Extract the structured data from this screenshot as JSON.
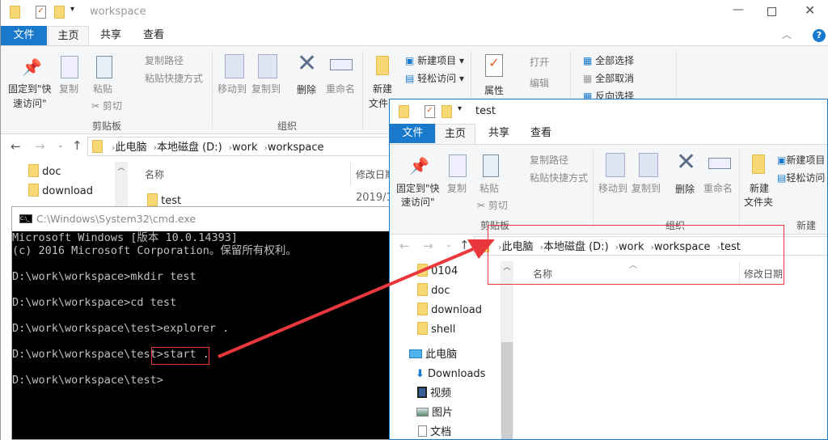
{
  "back_window": {
    "title": "workspace",
    "tabs": {
      "file": "文件",
      "home": "主页",
      "share": "共享",
      "view": "查看"
    },
    "ribbon": {
      "pin": "固定到\"快",
      "pin2": "速访问\"",
      "copy": "复制",
      "paste": "粘贴",
      "copy_path": "复制路径",
      "paste_shortcut": "粘贴快捷方式",
      "cut": "剪切",
      "clipboard": "剪贴板",
      "move_to": "移动到",
      "copy_to": "复制到",
      "delete": "删除",
      "rename": "重命名",
      "organize": "组织",
      "new_folder": "新建",
      "new_folder2": "文件夹",
      "new_item": "新建项目",
      "easy_access": "轻松访问",
      "properties": "属性",
      "open": "打开",
      "edit": "编辑",
      "select_all": "全部选择",
      "select_none": "全部取消",
      "invert": "反向选择"
    },
    "breadcrumb": [
      "此电脑",
      "本地磁盘 (D:)",
      "work",
      "workspace"
    ],
    "nav": [
      "doc",
      "download"
    ],
    "columns": {
      "name": "名称",
      "modified": "修改日期"
    },
    "files": [
      {
        "name": "test",
        "modified": "2019/1/"
      }
    ]
  },
  "cmd": {
    "title": "C:\\Windows\\System32\\cmd.exe",
    "lines": [
      "Microsoft Windows [版本 10.0.14393]",
      "(c) 2016 Microsoft Corporation。保留所有权利。",
      "",
      "D:\\work\\workspace>mkdir test",
      "",
      "D:\\work\\workspace>cd test",
      "",
      "D:\\work\\workspace\\test>explorer .",
      "",
      "D:\\work\\workspace\\test>start .",
      "",
      "D:\\work\\workspace\\test>"
    ]
  },
  "front_window": {
    "title": "test",
    "tabs": {
      "file": "文件",
      "home": "主页",
      "share": "共享",
      "view": "查看"
    },
    "ribbon": {
      "pin": "固定到\"快",
      "pin2": "速访问\"",
      "copy": "复制",
      "paste": "粘贴",
      "copy_path": "复制路径",
      "paste_shortcut": "粘贴快捷方式",
      "cut": "剪切",
      "clipboard": "剪贴板",
      "move_to": "移动到",
      "copy_to": "复制到",
      "delete": "删除",
      "rename": "重命名",
      "organize": "组织",
      "new_folder": "新建",
      "new_folder2": "文件夹",
      "new_item": "新建项目",
      "easy_access": "轻松访问",
      "new_group": "新建"
    },
    "breadcrumb": [
      "此电脑",
      "本地磁盘 (D:)",
      "work",
      "workspace",
      "test"
    ],
    "nav": [
      "0104",
      "doc",
      "download",
      "shell"
    ],
    "nav_special": [
      "此电脑",
      "Downloads",
      "视频",
      "图片",
      "文档"
    ],
    "columns": {
      "name": "名称",
      "modified": "修改日期"
    }
  },
  "annotation_color": "#e8383d",
  "accent": "#1979ca"
}
